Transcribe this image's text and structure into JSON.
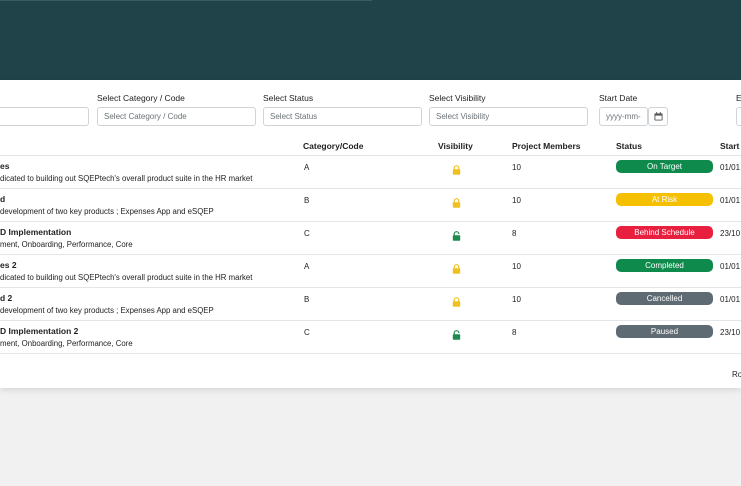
{
  "filters": {
    "category": {
      "label": "Select Category / Code",
      "placeholder": "Select Category / Code"
    },
    "status": {
      "label": "Select Status",
      "placeholder": "Select Status"
    },
    "visibility": {
      "label": "Select Visibility",
      "placeholder": "Select Visibility"
    },
    "start_date": {
      "label": "Start Date",
      "placeholder": "yyyy-mm-"
    },
    "end_date": {
      "label": "E"
    }
  },
  "table": {
    "headers": {
      "category": "Category/Code",
      "visibility": "Visibility",
      "members": "Project Members",
      "status": "Status",
      "start": "Start"
    },
    "rows": [
      {
        "name": "es",
        "desc": "dicated to building out SQEPtech's overall product suite in the HR market",
        "category": "A",
        "visibility": "locked",
        "members": "10",
        "status": "On Target",
        "status_color": "#0e8a4c",
        "start": "01/01"
      },
      {
        "name": "d",
        "desc": "development of two key products ; Expenses App and eSQEP",
        "category": "B",
        "visibility": "locked",
        "members": "10",
        "status": "At Risk",
        "status_color": "#f5c000",
        "start": "01/01"
      },
      {
        "name": "D Implementation",
        "desc": "ment, Onboarding, Performance, Core",
        "category": "C",
        "visibility": "unlocked",
        "members": "8",
        "status": "Behind Schedule",
        "status_color": "#e81f3f",
        "start": "23/10"
      },
      {
        "name": "es 2",
        "desc": "dicated to building out SQEPtech's overall product suite in the HR market",
        "category": "A",
        "visibility": "locked",
        "members": "10",
        "status": "Completed",
        "status_color": "#0e8a4c",
        "start": "01/01"
      },
      {
        "name": "d 2",
        "desc": "development of two key products ; Expenses App and eSQEP",
        "category": "B",
        "visibility": "locked",
        "members": "10",
        "status": "Cancelled",
        "status_color": "#5f6b73",
        "start": "01/01"
      },
      {
        "name": "D Implementation 2",
        "desc": "ment, Onboarding, Performance, Core",
        "category": "C",
        "visibility": "unlocked",
        "members": "8",
        "status": "Paused",
        "status_color": "#5f6b73",
        "start": "23/10"
      }
    ]
  },
  "footer": {
    "text": "Ro"
  },
  "colors": {
    "header": "#1f4349",
    "lock_yellow": "#f0c020",
    "lock_green": "#1d8a4e"
  },
  "icons": {
    "calendar": "calendar-icon",
    "locked": "lock-icon",
    "unlocked": "unlock-icon"
  }
}
